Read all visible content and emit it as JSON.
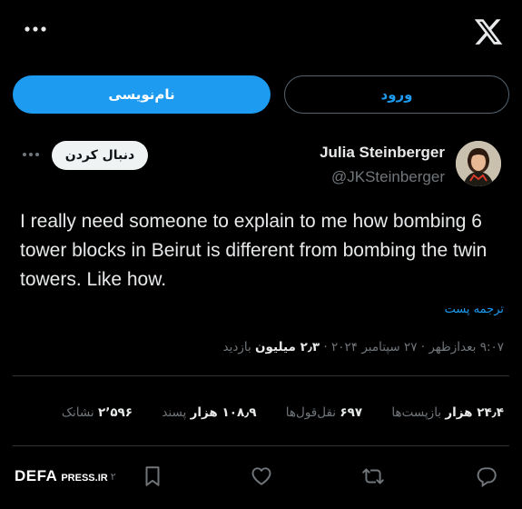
{
  "header": {
    "more_icon": "three-dots-icon",
    "logo": "x-logo"
  },
  "auth": {
    "signup_label": "نام‌نویسی",
    "login_label": "ورود"
  },
  "tweet": {
    "author_name": "Julia Steinberger",
    "author_handle": "@JKSteinberger",
    "follow_label": "دنبال کردن",
    "text": "I really need someone to explain to me how bombing 6 tower blocks in Beirut is different from bombing the twin towers. Like how.",
    "translate_label": "ترجمه پست",
    "timestamp": "۹:۰۷ بعدازظهر · ۲۷ سپتامبر ۲۰۲۴ · ",
    "views_value": "۲٫۳ میلیون",
    "views_label": " بازدید"
  },
  "stats": [
    {
      "value": "۲۴٫۴ هزار",
      "label": " بازپست‌ها"
    },
    {
      "value": "۶۹۷",
      "label": " نقل‌قول‌ها"
    },
    {
      "value": "۱۰۸٫۹ هزار",
      "label": " پسند"
    },
    {
      "value": "۲٬۵۹۶",
      "label": " نشانک"
    }
  ],
  "actions": {
    "reply_icon": "reply-icon",
    "retweet_icon": "retweet-icon",
    "like_icon": "heart-icon",
    "bookmark_icon": "bookmark-icon",
    "bookmark_count": "۲"
  },
  "watermark": {
    "brand": "DEFA",
    "site": "PRESS.IR"
  },
  "colors": {
    "accent": "#1d9bf0",
    "background": "#000000",
    "muted": "#71767b",
    "divider": "#2f3336"
  }
}
